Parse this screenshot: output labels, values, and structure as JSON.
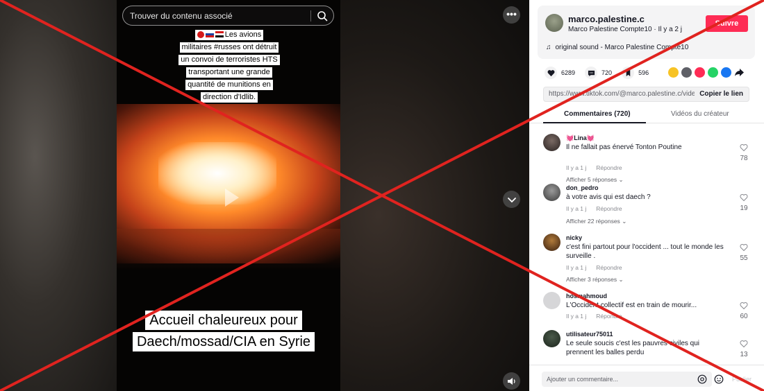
{
  "video": {
    "search_placeholder": "Trouver du contenu associé",
    "caption_top_lines": [
      "Les avions",
      "militaires #russes ont détruit",
      "un convoi de terroristes HTS",
      "transportant une grande",
      "quantité de munitions en",
      "direction d'Idlib."
    ],
    "caption_bottom_lines": [
      "Accueil chaleureux pour",
      "Daech/mossad/CIA en Syrie"
    ],
    "flag_colors": [
      "#d51a1a",
      "#1d3f9e",
      "#d51a1a"
    ]
  },
  "author": {
    "handle": "marco.palestine.c",
    "display_name": "Marco Palestine Compte10",
    "time": "Il y a 2 j",
    "follow_label": "Suivre",
    "sound": "original sound - Marco Palestine Compte10"
  },
  "stats": {
    "likes": "6289",
    "comments": "720",
    "saves": "596"
  },
  "share_colors": [
    "#f7c325",
    "#5f6067",
    "#fe2c55",
    "#25d366",
    "#1877f2",
    "#161823"
  ],
  "link": {
    "url": "https://www.tiktok.com/@marco.palestine.c/video...",
    "copy_label": "Copier le lien"
  },
  "tabs": {
    "comments": "Commentaires (720)",
    "videos": "Vidéos du créateur"
  },
  "comment_meta": {
    "reply_label": "Répondre"
  },
  "comments": [
    {
      "user": "💓Lina💓",
      "text": "Il ne fallait pas énervé Tonton Poutine",
      "time": "Il y a 1 j",
      "replies": "Afficher 5 réponses",
      "likes": "78"
    },
    {
      "user": "don_pedro",
      "text": "à votre avis qui est daech ?",
      "time": "Il y a 1 j",
      "replies": "Afficher 22 réponses",
      "likes": "19"
    },
    {
      "user": "nicky",
      "text": "c'est fini partout pour l'occident ... tout le monde les surveille .",
      "time": "Il y a 1 j",
      "replies": "Afficher 3 réponses",
      "likes": "55"
    },
    {
      "user": "hosmahmoud",
      "text": "L'Occident collectif est en train de mourir...",
      "time": "Il y a 1 j",
      "replies": "",
      "likes": "60"
    },
    {
      "user": "utilisateur75011",
      "text": "Le seule soucis c'est les pauvres civiles qui prennent les balles perdu",
      "time": "",
      "replies": "",
      "likes": "13"
    }
  ],
  "comment_box": {
    "placeholder": "Ajouter un commentaire...",
    "post_label": "Publier"
  },
  "accent_colors": {
    "brand": "#fe2c55",
    "overlay_cross": "#e0231f"
  }
}
